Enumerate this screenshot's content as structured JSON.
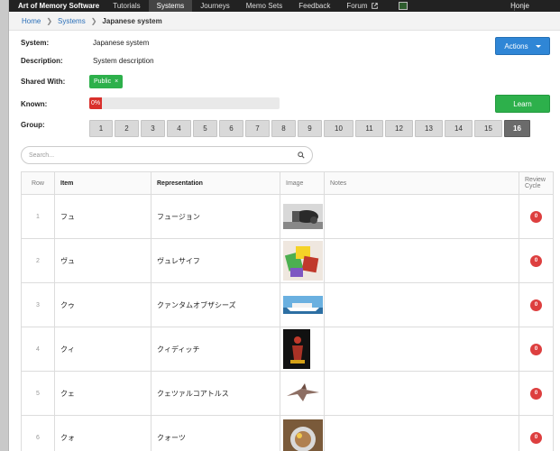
{
  "navbar": {
    "brand": "Art of Memory Software",
    "items": [
      "Tutorials",
      "Systems",
      "Journeys",
      "Memo Sets",
      "Feedback",
      "Forum"
    ],
    "forum_icon": "external-link-icon",
    "user": "Honje"
  },
  "breadcrumb": {
    "home": "Home",
    "systems": "Systems",
    "current": "Japanese system"
  },
  "details": {
    "system_label": "System:",
    "system_value": "Japanese system",
    "description_label": "Description:",
    "description_value": "System description",
    "shared_label": "Shared With:",
    "shared_tag": "Public",
    "shared_tag_remove": "×",
    "known_label": "Known:",
    "known_value": "0%",
    "known_fraction": 0,
    "group_label": "Group:"
  },
  "actions_label": "Actions",
  "learn_label": "Learn",
  "groups": [
    "1",
    "2",
    "3",
    "4",
    "5",
    "6",
    "7",
    "8",
    "9",
    "10",
    "11",
    "12",
    "13",
    "14",
    "15",
    "16"
  ],
  "active_group": "16",
  "search": {
    "placeholder": "Search..."
  },
  "table": {
    "headers": {
      "row": "Row",
      "item": "Item",
      "representation": "Representation",
      "image": "Image",
      "notes": "Notes",
      "review": "Review Cycle"
    },
    "rows": [
      {
        "row": "1",
        "item": "フュ",
        "representation": "フュージョン",
        "notes": "",
        "review": "0"
      },
      {
        "row": "2",
        "item": "ヴュ",
        "representation": "ヴュレサイフ",
        "notes": "",
        "review": "0"
      },
      {
        "row": "3",
        "item": "クゥ",
        "representation": "クァンタムオブザシーズ",
        "notes": "",
        "review": "0"
      },
      {
        "row": "4",
        "item": "クィ",
        "representation": "クィディッチ",
        "notes": "",
        "review": "0"
      },
      {
        "row": "5",
        "item": "クェ",
        "representation": "クェツァルコアトルス",
        "notes": "",
        "review": "0"
      },
      {
        "row": "6",
        "item": "クォ",
        "representation": "クォーツ",
        "notes": "",
        "review": "0"
      }
    ]
  },
  "colors": {
    "navbar": "#222222",
    "primary": "#2f86d6",
    "success": "#2db04b",
    "danger": "#d9302c"
  }
}
